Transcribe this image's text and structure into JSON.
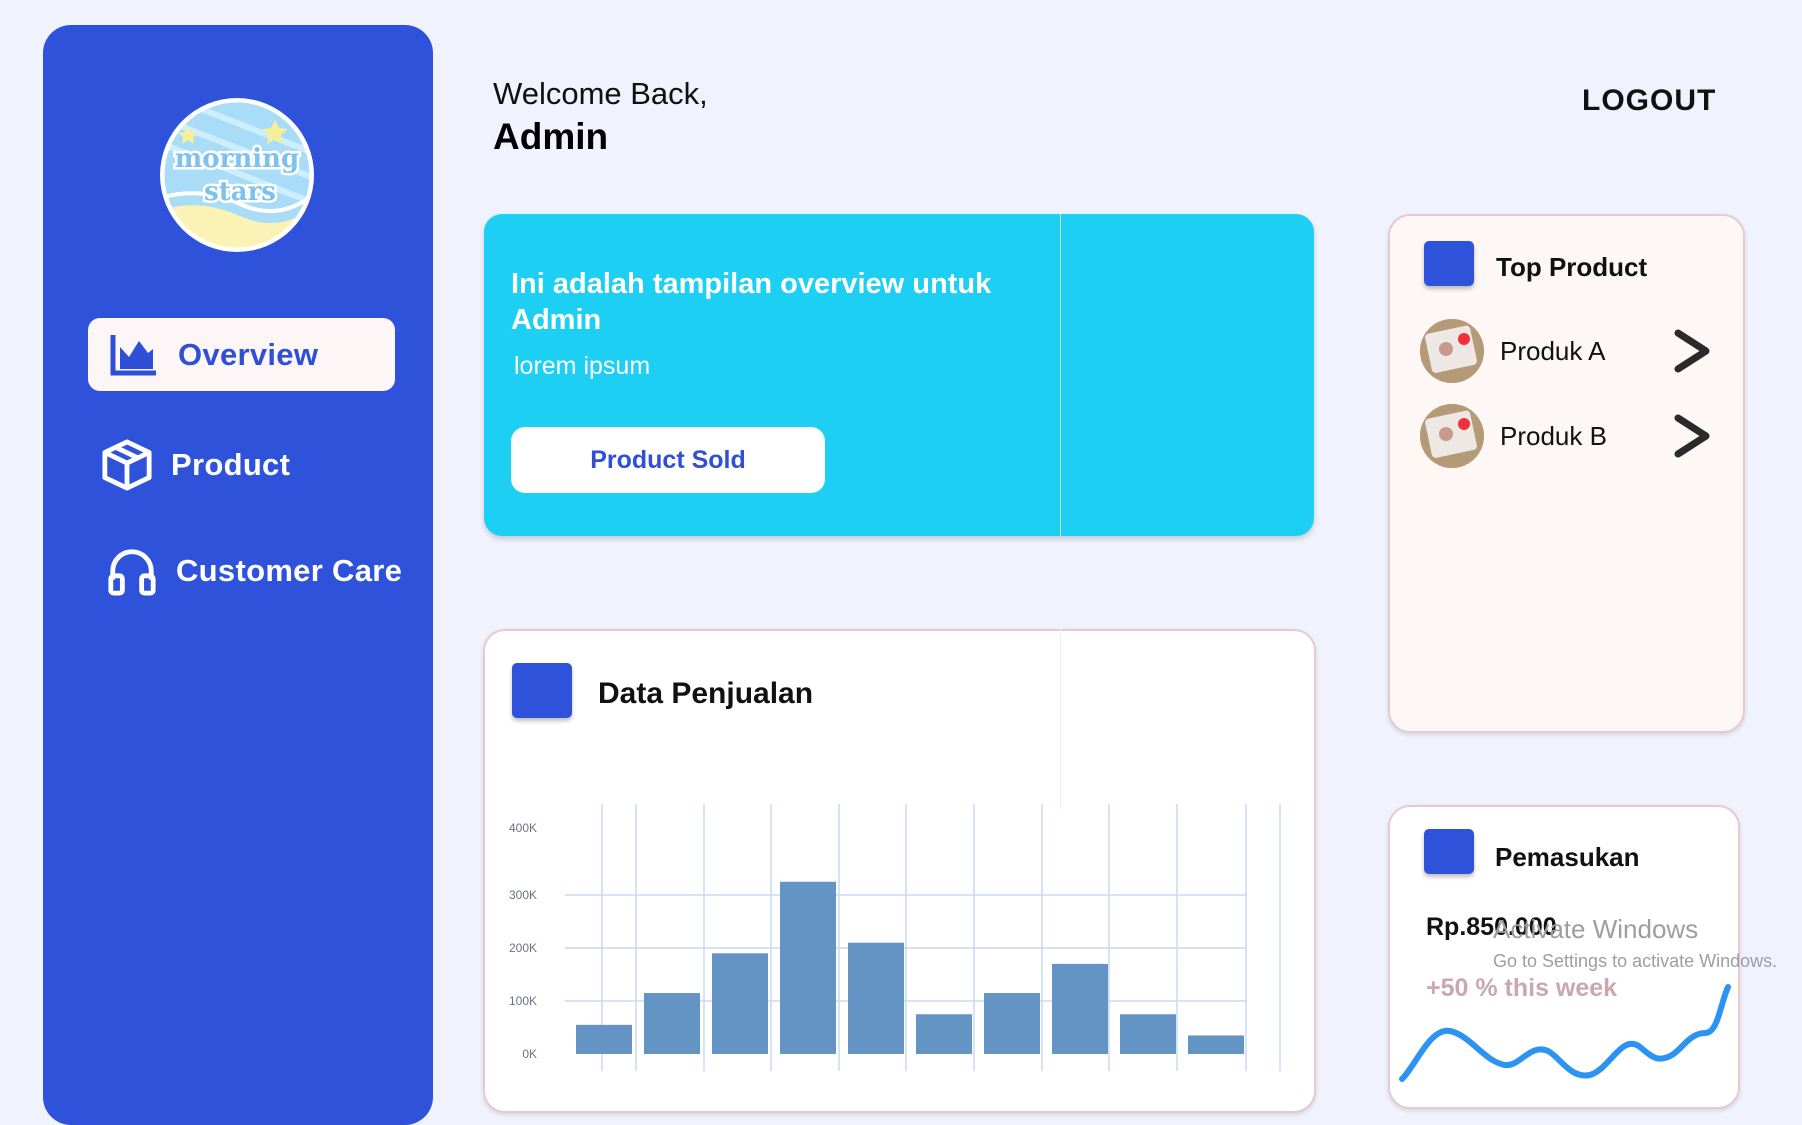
{
  "sidebar": {
    "logo": {
      "line1": "morning",
      "line2": "stars"
    },
    "items": [
      {
        "label": "Overview",
        "icon": "chart-area-icon",
        "active": true
      },
      {
        "label": "Product",
        "icon": "box-icon",
        "active": false
      },
      {
        "label": "Customer Care",
        "icon": "headphones-icon",
        "active": false
      }
    ]
  },
  "header": {
    "welcome": "Welcome Back,",
    "user": "Admin",
    "logout": "LOGOUT"
  },
  "banner": {
    "title": "Ini adalah tampilan overview untuk Admin",
    "subtitle": "lorem ipsum",
    "button": "Product Sold"
  },
  "sales": {
    "title": "Data Penjualan"
  },
  "chart_data": {
    "type": "bar",
    "yticks": [
      "0K",
      "100K",
      "200K",
      "300K",
      "400K"
    ],
    "ylim": [
      0,
      400000
    ],
    "values": [
      55000,
      115000,
      190000,
      325000,
      210000,
      75000,
      115000,
      170000,
      75000,
      35000
    ],
    "bar_color": "#6394C4",
    "grid": true
  },
  "top_product": {
    "title": "Top Product",
    "items": [
      {
        "name": "Produk A"
      },
      {
        "name": "Produk B"
      }
    ]
  },
  "income": {
    "title": "Pemasukan",
    "value": "Rp.850.000",
    "change": "+50 % this week",
    "line_color": "#2C93F2"
  },
  "overlay": {
    "line1": "Activate Windows",
    "line2": "Go to Settings to activate Windows."
  },
  "colors": {
    "sidebar": "#2F52DB",
    "banner": "#1ECFF4",
    "background": "#F0F3FE"
  }
}
